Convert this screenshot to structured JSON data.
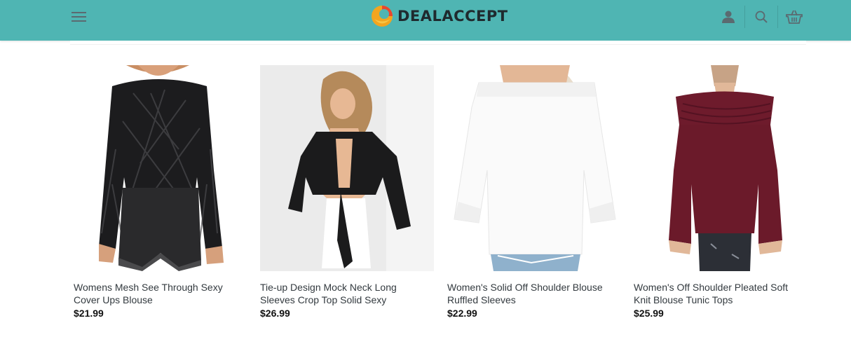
{
  "header": {
    "brand": "DEALACCEPT",
    "icons": [
      "menu-icon",
      "user-icon",
      "search-icon",
      "basket-icon"
    ],
    "background_color": "#4fb5b3"
  },
  "products": [
    {
      "title": "Womens Mesh See Through Sexy Cover Ups Blouse",
      "price": "$21.99"
    },
    {
      "title": "Tie-up Design Mock Neck Long Sleeves Crop Top Solid Sexy",
      "price": "$26.99"
    },
    {
      "title": "Women's Solid Off Shoulder Blouse Ruffled Sleeves",
      "price": "$22.99"
    },
    {
      "title": "Women's Off Shoulder Pleated Soft Knit Blouse Tunic Tops",
      "price": "$25.99"
    }
  ]
}
